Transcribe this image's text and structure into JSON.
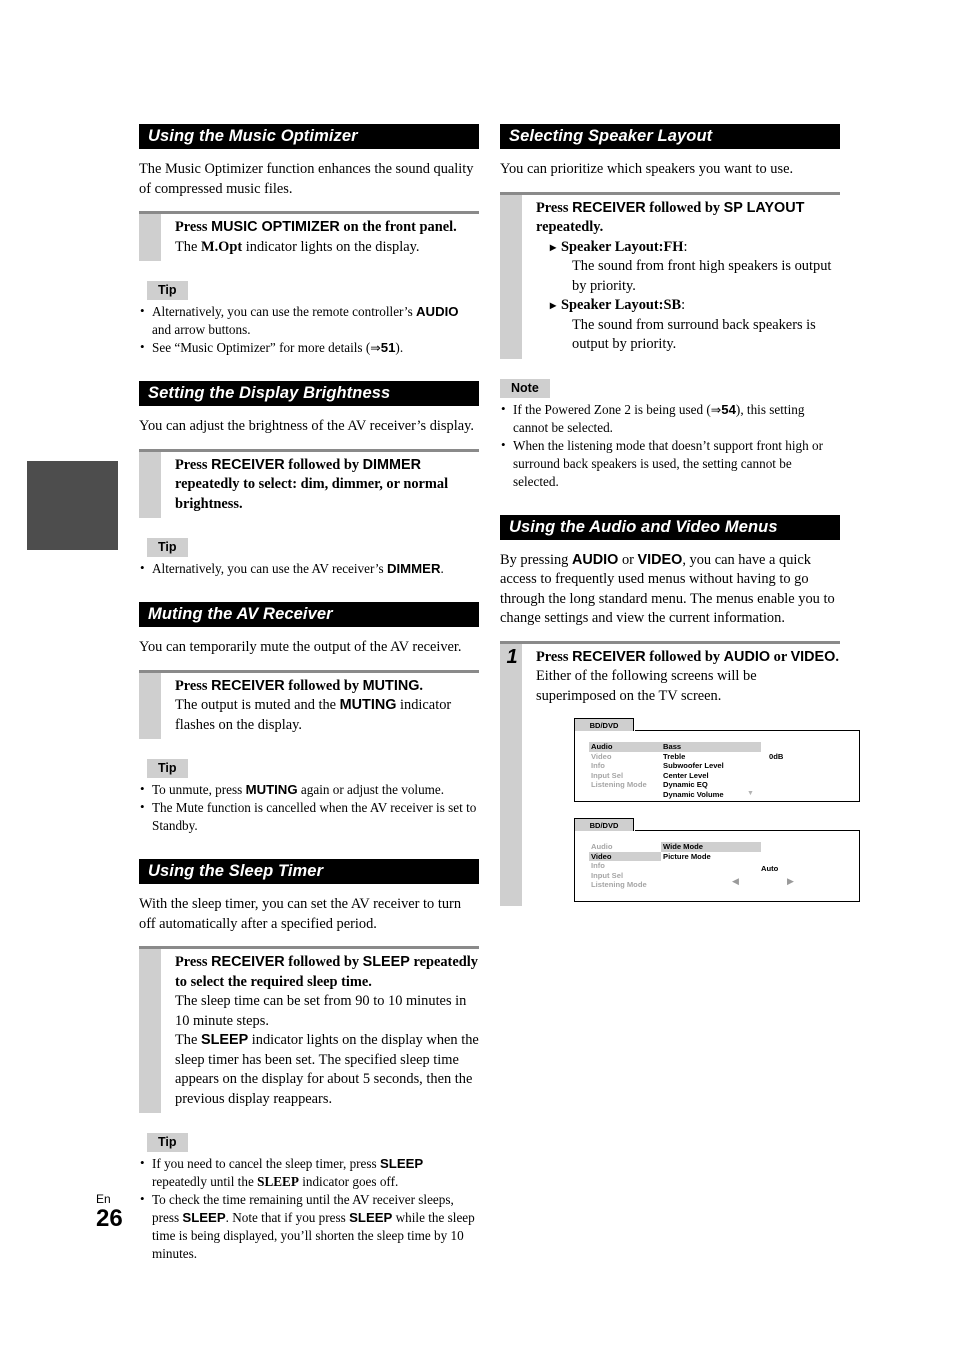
{
  "page": {
    "language_code": "En",
    "number": "26",
    "margin_tab_color": "#4d4d4d"
  },
  "left_column": {
    "sections": [
      {
        "title": "Using the Music Optimizer",
        "intro": "The Music Optimizer function enhances the sound quality of compressed music files.",
        "instruction": {
          "lead_plain_1": "Press ",
          "lead_bold_1": "MUSIC OPTIMIZER",
          "lead_plain_2": " on the front panel.",
          "sub_plain_1": "The ",
          "sub_bold_1": "M.Opt",
          "sub_plain_2": " indicator lights on the display."
        },
        "callout": {
          "badge": "Tip",
          "bullets": [
            {
              "p1": "Alternatively, you can use the remote controller’s ",
              "b1": "AUDIO",
              "p2": " and arrow buttons."
            },
            {
              "p1": "See “Music Optimizer” for more details (",
              "arrow": "⇒",
              "ref": "51",
              "p2": ")."
            }
          ]
        }
      },
      {
        "title": "Setting the Display Brightness",
        "intro": "You can adjust the brightness of the AV receiver’s display.",
        "instruction": {
          "lead_plain_1": "Press ",
          "lead_bold_1": "RECEIVER",
          "lead_plain_2": " followed by ",
          "lead_bold_2": "DIMMER",
          "lead_plain_3": " repeatedly to select: dim, dimmer, or normal brightness."
        },
        "callout": {
          "badge": "Tip",
          "bullets": [
            {
              "p1": "Alternatively, you can use the AV receiver’s ",
              "b1": "DIMMER",
              "p2": "."
            }
          ]
        }
      },
      {
        "title": "Muting the AV Receiver",
        "intro": "You can temporarily mute the output of the AV receiver.",
        "instruction": {
          "lead_plain_1": "Press ",
          "lead_bold_1": "RECEIVER",
          "lead_plain_2": " followed by ",
          "lead_bold_2": "MUTING",
          "lead_plain_3": ".",
          "sub_plain_1": "The output is muted and the ",
          "sub_bold_1": "MUTING",
          "sub_plain_2": " indicator flashes on the display."
        },
        "callout": {
          "badge": "Tip",
          "bullets": [
            {
              "p1": "To unmute, press ",
              "b1": "MUTING",
              "p2": " again or adjust the volume."
            },
            {
              "p1": "The Mute function is cancelled when the AV receiver is set to Standby."
            }
          ]
        }
      },
      {
        "title": "Using the Sleep Timer",
        "intro": "With the sleep timer, you can set the AV receiver to turn off automatically after a specified period.",
        "instruction": {
          "lead_plain_1": "Press ",
          "lead_bold_1": "RECEIVER",
          "lead_plain_2": " followed by ",
          "lead_bold_2": "SLEEP",
          "lead_plain_3": " repeatedly to select the required sleep time.",
          "sub_line_1": "The sleep time can be set from 90 to 10 minutes in 10 minute steps.",
          "sub_plain_1": "The ",
          "sub_bold_1": "SLEEP",
          "sub_plain_2": " indicator lights on the display when the sleep timer has been set. The specified sleep time appears on the display for about 5 seconds, then the previous display reappears."
        },
        "callout": {
          "badge": "Tip",
          "bullets": [
            {
              "p1": "If you need to cancel the sleep timer, press ",
              "b1": "SLEEP",
              "p2": " repeatedly until the ",
              "b2": "SLEEP",
              "p3": " indicator goes off."
            },
            {
              "p1": "To check the time remaining until the AV receiver sleeps, press ",
              "b1": "SLEEP",
              "p2": ". Note that if you press ",
              "b2": "SLEEP",
              "p3": " while the sleep time is being displayed, you’ll shorten the sleep time by 10 minutes."
            }
          ]
        }
      }
    ]
  },
  "right_column": {
    "speaker_layout": {
      "title": "Selecting Speaker Layout",
      "intro": "You can prioritize which speakers you want to use.",
      "instruction": {
        "lead_plain_1": "Press ",
        "lead_bold_1": "RECEIVER",
        "lead_plain_2": " followed by ",
        "lead_bold_2": "SP LAYOUT",
        "lead_plain_3": " repeatedly.",
        "items": [
          {
            "head_bold": "Speaker Layout:FH",
            "head_tail": ":",
            "body": "The sound from front high speakers is output by priority."
          },
          {
            "head_bold": "Speaker Layout:SB",
            "head_tail": ":",
            "body": "The sound from surround back speakers is output by priority."
          }
        ]
      },
      "callout": {
        "badge": "Note",
        "bullets": [
          {
            "p1": "If the Powered Zone 2 is being used (",
            "arrow": "⇒",
            "ref": "54",
            "p2": "), this setting cannot be selected."
          },
          {
            "p1": "When the listening mode that doesn’t support front high or surround back speakers is used, the setting cannot be selected."
          }
        ]
      }
    },
    "audio_video_menus": {
      "title": "Using the Audio and Video Menus",
      "intro_p1": "By pressing ",
      "intro_b1": "AUDIO",
      "intro_p2": " or ",
      "intro_b2": "VIDEO",
      "intro_p3": ", you can have a quick access to frequently used menus without having to go through the long standard menu. The menus enable you to change settings and view the current information.",
      "step": {
        "number": "1",
        "lead_plain_1": "Press ",
        "lead_bold_1": "RECEIVER",
        "lead_plain_2": " followed by ",
        "lead_bold_2": "AUDIO",
        "lead_plain_3": " or ",
        "lead_bold_3": "VIDEO",
        "lead_plain_4": ".",
        "sub": "Either of the following screens will be superimposed on the TV screen."
      },
      "osd_screens": [
        {
          "tab_label": "BD/DVD",
          "left_menu": [
            "Audio",
            "Video",
            "Info",
            "Input Sel",
            "Listening Mode"
          ],
          "left_selected_index": 0,
          "right_menu": [
            "Bass",
            "Treble",
            "Subwoofer Level",
            "Center Level",
            "Dynamic EQ",
            "Dynamic Volume"
          ],
          "right_selected_index": 0,
          "value": "0dB",
          "scroll_caret": "▼"
        },
        {
          "tab_label": "BD/DVD",
          "left_menu": [
            "Audio",
            "Video",
            "Info",
            "Input Sel",
            "Listening Mode"
          ],
          "left_selected_index": 1,
          "right_menu": [
            "Wide Mode",
            "Picture Mode"
          ],
          "right_selected_index": 0,
          "value": "Auto",
          "left_arrow": "◀",
          "right_arrow": "▶"
        }
      ]
    }
  }
}
